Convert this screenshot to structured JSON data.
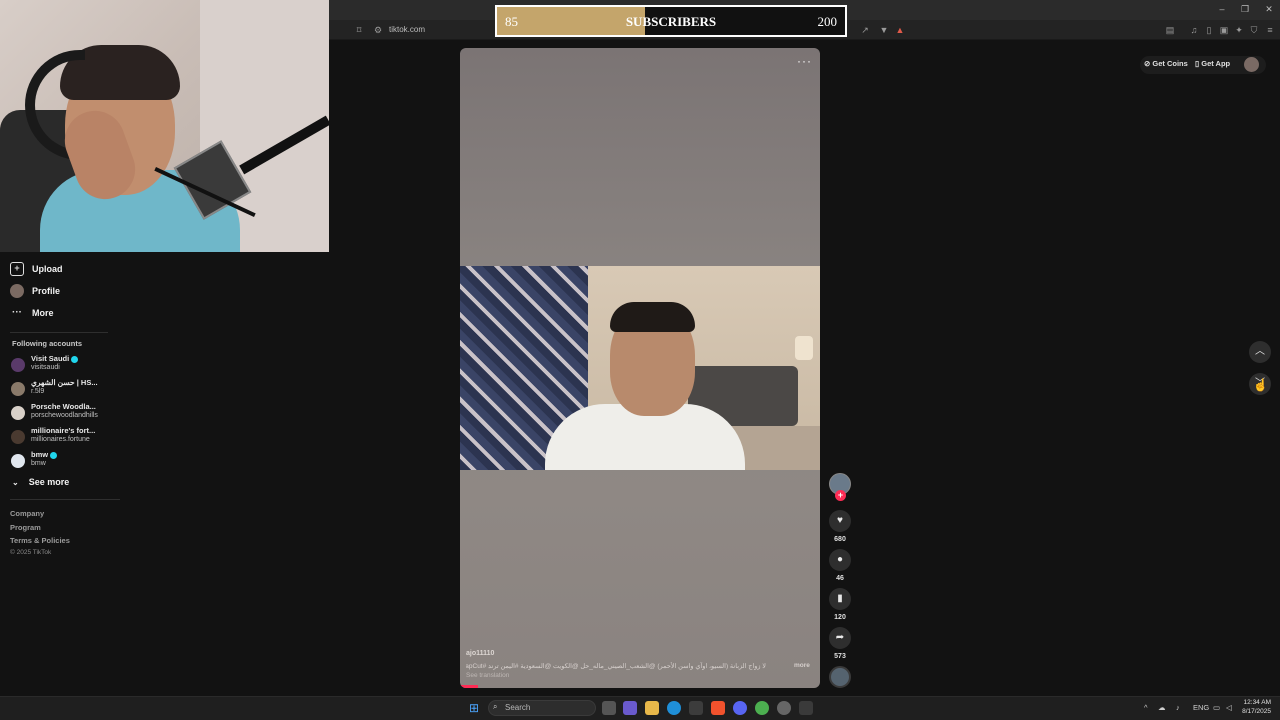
{
  "browser": {
    "url": "tiktok.com",
    "window_controls": {
      "minimize": "–",
      "restore": "❐",
      "close": "✕"
    }
  },
  "subscriber_goal": {
    "current": "85",
    "label": "SUBSCRIBERS",
    "goal": "200",
    "progress": 0.425,
    "fill_color": "#c4a56b"
  },
  "sidebar": {
    "items": [
      {
        "label": "Upload",
        "icon": "upload-icon"
      },
      {
        "label": "Profile",
        "icon": "profile-avatar-icon"
      },
      {
        "label": "More",
        "icon": "more-dots-icon"
      }
    ],
    "following_title": "Following accounts",
    "accounts": [
      {
        "name": "Visit Saudi",
        "handle": "visitsaudi",
        "verified": true,
        "avatar_color": "#5a3a6a"
      },
      {
        "name": "حسن الشهري | HS...",
        "handle": "r.5l9",
        "verified": false,
        "avatar_color": "#8a7a6a"
      },
      {
        "name": "Porsche Woodla...",
        "handle": "porschewoodlandhills",
        "verified": false,
        "avatar_color": "#d8d0c8"
      },
      {
        "name": "millionaire's fort...",
        "handle": "millionaires.fortune",
        "verified": false,
        "avatar_color": "#4a3a30"
      },
      {
        "name": "bmw",
        "handle": "bmw",
        "verified": true,
        "avatar_color": "#e0e6ee"
      }
    ],
    "see_more": "See more",
    "footer_links": [
      "Company",
      "Program",
      "Terms & Policies"
    ],
    "copyright": "© 2025 TikTok"
  },
  "video": {
    "more_menu": "···",
    "author": "ajo11110",
    "caption": "لا زواج الزبانة (السيو، اوآي واسن الأحمر) @الشعب_الصيني_ماله_حل @الكويت @السعودية #اليمن ترند #CapCut",
    "caption_more": "more",
    "translation": "See translation",
    "progress": 0.05
  },
  "actions": {
    "follow": "+",
    "likes": "680",
    "comments": "46",
    "saves": "120",
    "shares": "573"
  },
  "top_right": {
    "get_coins": "Get Coins",
    "get_app": "Get App"
  },
  "taskbar": {
    "search_placeholder": "Search",
    "language": "ENG",
    "time": "12:34 AM",
    "date": "8/17/2025"
  },
  "colors": {
    "tiktok_red": "#fe2c55",
    "verified_blue": "#20d5ec",
    "background": "#121212"
  }
}
